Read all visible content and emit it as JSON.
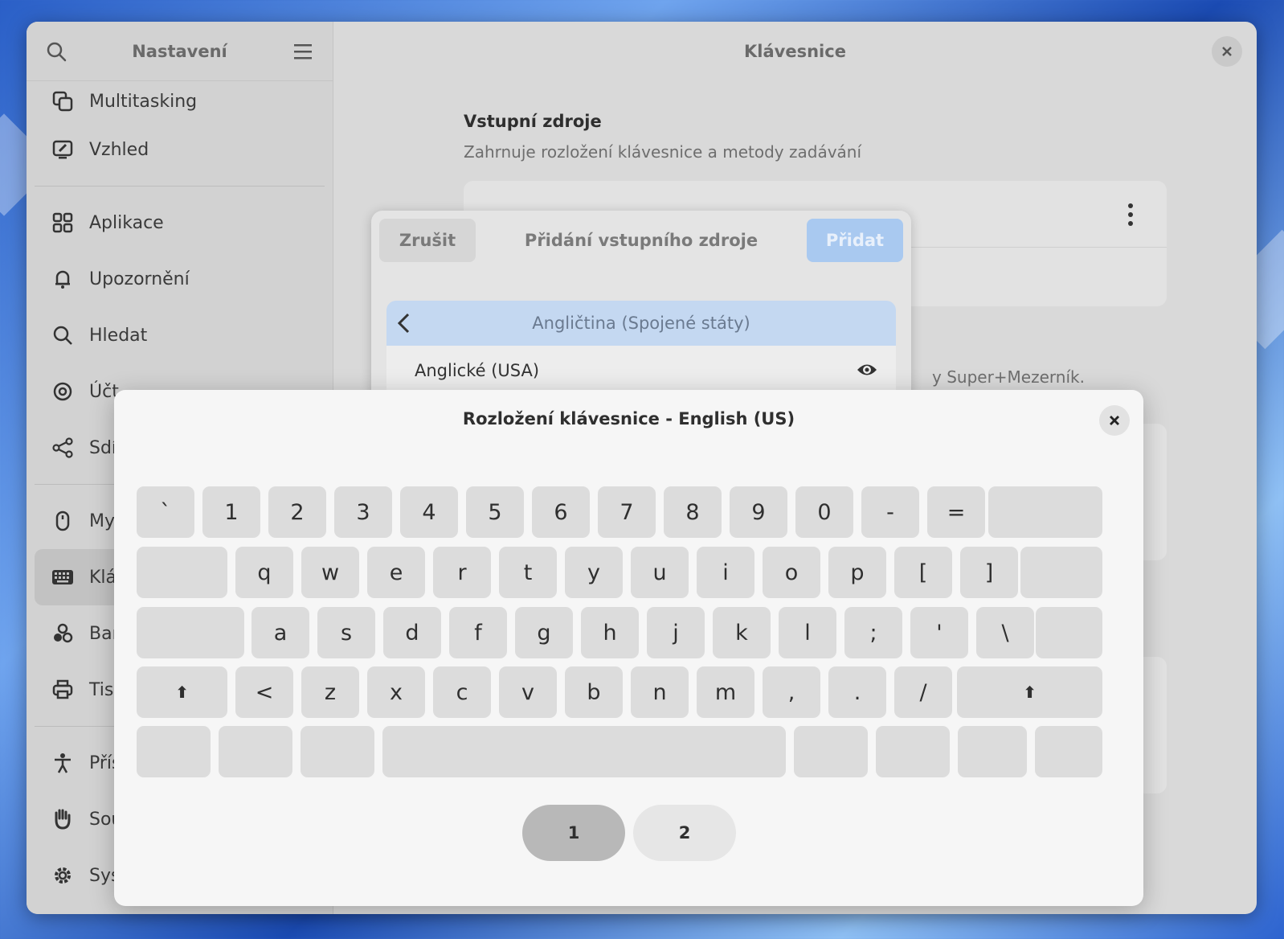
{
  "sidebar": {
    "title": "Nastavení",
    "items": [
      {
        "label": "Multitasking",
        "icon": "multitasking-icon"
      },
      {
        "label": "Vzhled",
        "icon": "appearance-icon"
      },
      {
        "label": "Aplikace",
        "icon": "apps-icon"
      },
      {
        "label": "Upozornění",
        "icon": "bell-icon"
      },
      {
        "label": "Hledat",
        "icon": "search-icon"
      },
      {
        "label": "Účt",
        "icon": "at-icon"
      },
      {
        "label": "Sdí",
        "icon": "share-icon"
      },
      {
        "label": "My",
        "icon": "mouse-icon"
      },
      {
        "label": "Klá",
        "icon": "keyboard-icon"
      },
      {
        "label": "Bar",
        "icon": "color-icon"
      },
      {
        "label": "Tis",
        "icon": "printer-icon"
      },
      {
        "label": "Přís",
        "icon": "accessibility-icon"
      },
      {
        "label": "Sou",
        "icon": "hand-icon"
      },
      {
        "label": "Sys",
        "icon": "gear-icon"
      }
    ]
  },
  "main": {
    "title": "Klávesnice",
    "section_title": "Vstupní zdroje",
    "section_subtitle": "Zahrnuje rozložení klávesnice a metody zadávání",
    "hint": "y Super+Mezerník."
  },
  "add_dialog": {
    "cancel": "Zrušit",
    "title": "Přidání vstupního zdroje",
    "add": "Přidat",
    "selected_language": "Angličtina (Spojené státy)",
    "layout_row": "Anglické (USA)"
  },
  "keyboard_dialog": {
    "title": "Rozložení klávesnice - English (US)",
    "rows": [
      [
        "`",
        "1",
        "2",
        "3",
        "4",
        "5",
        "6",
        "7",
        "8",
        "9",
        "0",
        "-",
        "="
      ],
      [
        "q",
        "w",
        "e",
        "r",
        "t",
        "y",
        "u",
        "i",
        "o",
        "p",
        "[",
        "]"
      ],
      [
        "a",
        "s",
        "d",
        "f",
        "g",
        "h",
        "j",
        "k",
        "l",
        ";",
        "'",
        "\\"
      ],
      [
        "⬆",
        "<",
        "z",
        "x",
        "c",
        "v",
        "b",
        "n",
        "m",
        ",",
        ".",
        "/",
        "⬆"
      ]
    ],
    "levels": [
      "1",
      "2"
    ],
    "active_level": "1"
  },
  "colors": {
    "accent_selected": "#c4d8f1",
    "add_button": "#a9c9f0"
  }
}
